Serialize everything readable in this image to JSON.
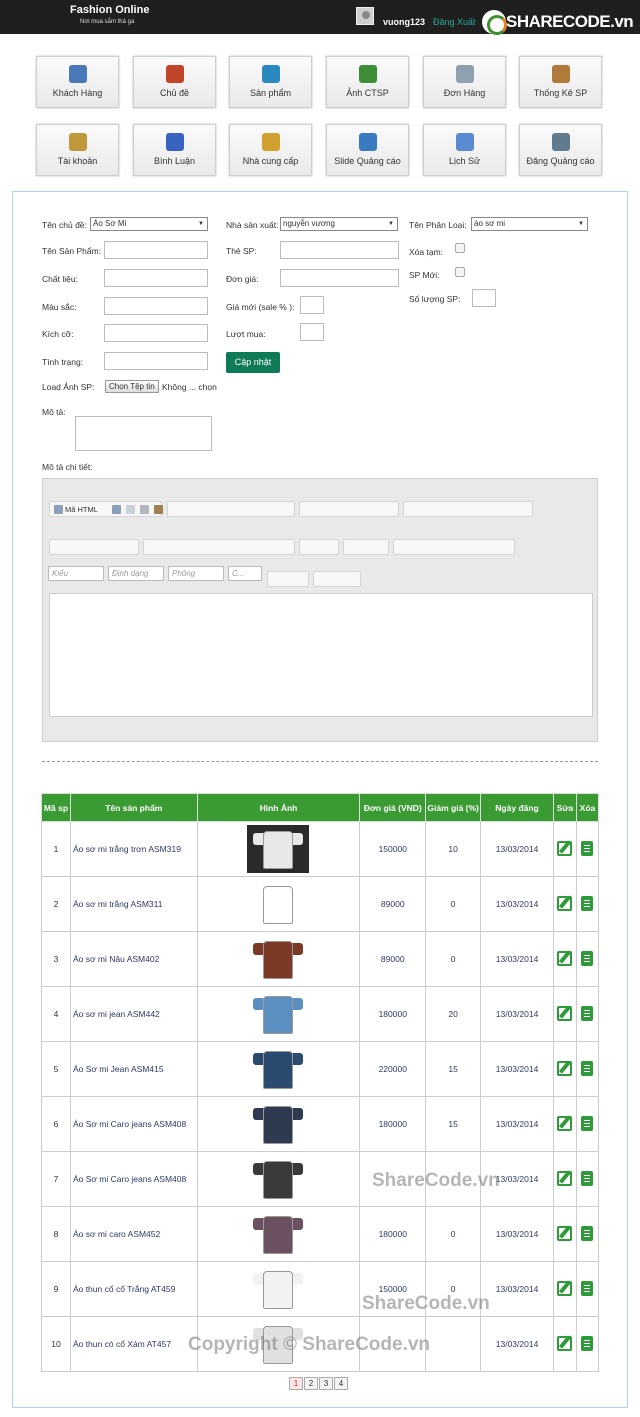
{
  "header": {
    "brand": "Fashion Online",
    "slogan": "Nơi mua sắm thả ga",
    "username": "vuong123",
    "logout": "Đăng Xuất",
    "logo_text": "SHARECODE.vn"
  },
  "nav": [
    {
      "label": "Khách Hàng",
      "icon": "customer-icon",
      "color": "#4a78b8"
    },
    {
      "label": "Chủ đề",
      "icon": "home-icon",
      "color": "#c0462a"
    },
    {
      "label": "Sản phẩm",
      "icon": "basket-icon",
      "color": "#2a8ac0"
    },
    {
      "label": "Ảnh CTSP",
      "icon": "picture-icon",
      "color": "#3f8f3a"
    },
    {
      "label": "Đơn Hàng",
      "icon": "document-icon",
      "color": "#8fa0b0"
    },
    {
      "label": "Thống Kê SP",
      "icon": "clipboard-icon",
      "color": "#b07a3a"
    },
    {
      "label": "Tài khoản",
      "icon": "users-icon",
      "color": "#c09a3a"
    },
    {
      "label": "Bình Luận",
      "icon": "pencil-icon",
      "color": "#3a62c0"
    },
    {
      "label": "Nhà cung cấp",
      "icon": "supplier-icon",
      "color": "#d0a030"
    },
    {
      "label": "Slide Quảng cáo",
      "icon": "monitor-icon",
      "color": "#3a7ac0"
    },
    {
      "label": "Lịch Sử",
      "icon": "history-icon",
      "color": "#5a8ad0"
    },
    {
      "label": "Đăng Quảng cáo",
      "icon": "tv-icon",
      "color": "#607a90"
    }
  ],
  "form": {
    "topic_label": "Tên chủ đề:",
    "topic_value": "Áo Sơ Mi",
    "maker_label": "Nhà sản xuất:",
    "maker_value": "nguyễn vương",
    "category_label": "Tên Phân Loại:",
    "category_value": "áo sơ mi",
    "product_name_label": "Tên Sản Phẩm:",
    "tag_label": "Thẻ SP:",
    "delete_temp_label": "Xóa tạm:",
    "material_label": "Chất liệu:",
    "price_label": "Đơn giá:",
    "new_label": "SP Mới:",
    "color_label": "Màu sắc:",
    "sale_label": "Giá mới (sale % ):",
    "qty_label": "Số lượng SP:",
    "size_label": "Kích cỡ:",
    "views_label": "Lượt mua:",
    "status_label": "Tình trạng:",
    "update_button": "Cập nhật",
    "image_label": "Load Ảnh SP:",
    "file_button": "Chọn Tệp tin",
    "file_status": "Không ... chọn",
    "desc_label": "Mô tả:",
    "detail_label": "Mô tả chi tiết:"
  },
  "editor": {
    "source_label": "Mã HTML",
    "style": "Kiểu",
    "format": "Định dạng",
    "font": "Phông",
    "size": "C..."
  },
  "table": {
    "headers": [
      "Mã sp",
      "Tên sản phẩm",
      "Hình Ảnh",
      "Đơn giá (VND)",
      "Giảm giá (%)",
      "Ngày đăng",
      "Sửa",
      "Xóa"
    ],
    "rows": [
      {
        "id": "1",
        "name": "Áo sơ mi trắng trơn ASM319",
        "price": "150000",
        "sale": "10",
        "date": "13/03/2014",
        "color": "#e8e8e8",
        "bg": "#2a2a2a"
      },
      {
        "id": "2",
        "name": "Áo sơ mi trắng ASM311",
        "price": "89000",
        "sale": "0",
        "date": "13/03/2014",
        "color": "#ffffff",
        "bg": "#ffffff"
      },
      {
        "id": "3",
        "name": "Áo sơ mi Nâu ASM402",
        "price": "89000",
        "sale": "0",
        "date": "13/03/2014",
        "color": "#7a3a26",
        "bg": "#ffffff"
      },
      {
        "id": "4",
        "name": "Áo sơ mi jean ASM442",
        "price": "180000",
        "sale": "20",
        "date": "13/03/2014",
        "color": "#5a8fc0",
        "bg": "#ffffff"
      },
      {
        "id": "5",
        "name": "Áo Sơ mi Jean ASM415",
        "price": "220000",
        "sale": "15",
        "date": "13/03/2014",
        "color": "#2a4a70",
        "bg": "#ffffff"
      },
      {
        "id": "6",
        "name": "Áo Sơ mi Caro jeans ASM408",
        "price": "180000",
        "sale": "15",
        "date": "13/03/2014",
        "color": "#2e3a50",
        "bg": "#ffffff"
      },
      {
        "id": "7",
        "name": "Áo Sơ mi Caro jeans ASM408",
        "price": "",
        "sale": "",
        "date": "13/03/2014",
        "color": "#3a3a3a",
        "bg": "#ffffff"
      },
      {
        "id": "8",
        "name": "Áo sơ mi caro ASM452",
        "price": "180000",
        "sale": "0",
        "date": "13/03/2014",
        "color": "#6a5060",
        "bg": "#ffffff"
      },
      {
        "id": "9",
        "name": "Áo thun cổ cổ Trắng AT459",
        "price": "150000",
        "sale": "0",
        "date": "13/03/2014",
        "color": "#f2f2f2",
        "bg": "#ffffff"
      },
      {
        "id": "10",
        "name": "Áo thun có cổ Xám AT457",
        "price": "",
        "sale": "",
        "date": "13/03/2014",
        "color": "#e0e0e0",
        "bg": "#ffffff"
      }
    ]
  },
  "pager": [
    "1",
    "2",
    "3",
    "4"
  ],
  "watermarks": [
    "ShareCode.vn",
    "ShareCode.vn",
    "Copyright © ShareCode.vn"
  ]
}
